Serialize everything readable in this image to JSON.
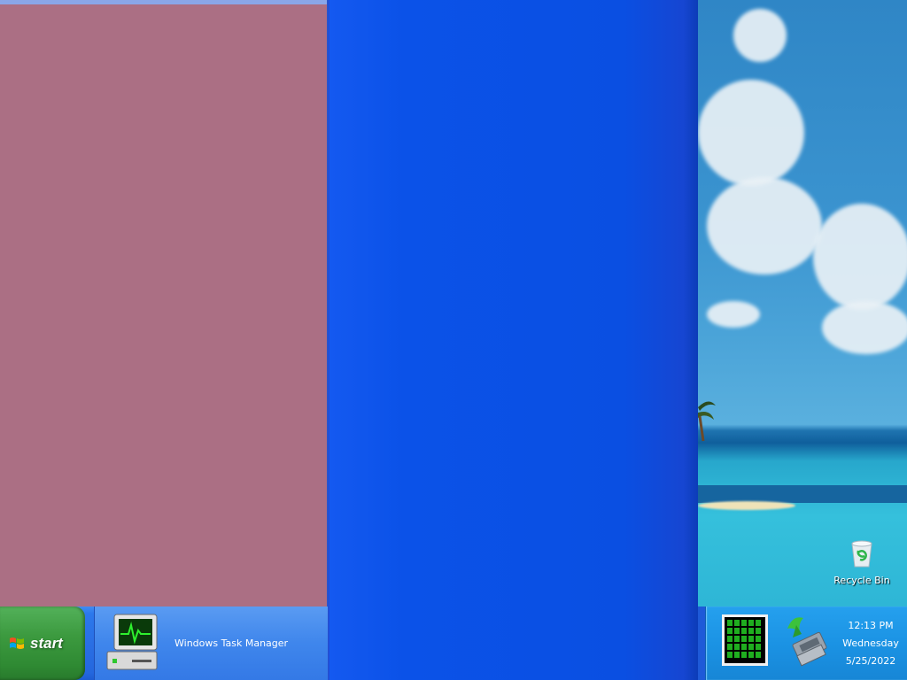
{
  "taskbar": {
    "start_label": "start",
    "tasks": [
      {
        "label": "Windows Task Manager",
        "icon": "task-manager-icon"
      }
    ]
  },
  "tray": {
    "icons": [
      "cpu-usage-icon",
      "network-icon"
    ],
    "clock": {
      "time": "12:13 PM",
      "day": "Wednesday",
      "date": "5/25/2022"
    }
  },
  "desktop": {
    "icons": [
      {
        "label": "Recycle Bin",
        "icon": "recycle-bin-icon"
      }
    ]
  },
  "colors": {
    "left_pane": "#ab6f84",
    "center_pane": "#0a4fe2",
    "start_button": "#3c9a3f",
    "taskbar": "#2a6fe4"
  }
}
